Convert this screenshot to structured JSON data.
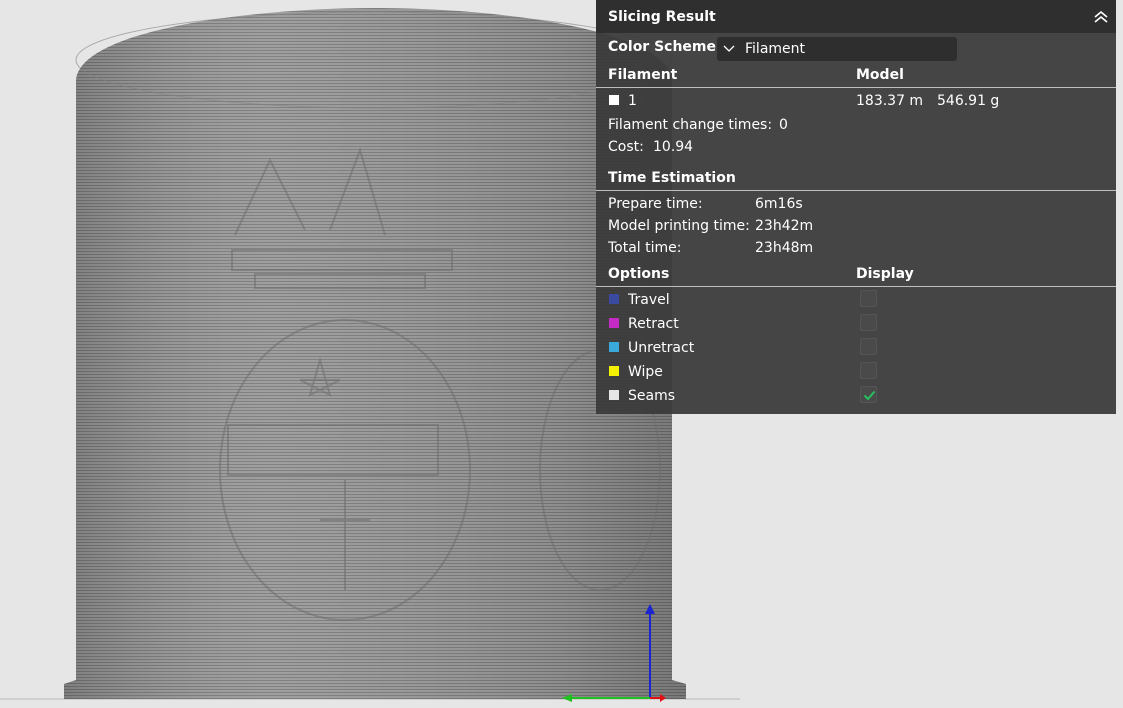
{
  "panel": {
    "title": "Slicing Result",
    "collapse_icon": "double-chevron-up-icon",
    "color_scheme": {
      "label": "Color Scheme",
      "selected": "Filament",
      "icon": "chevron-down-icon"
    },
    "filament_header": "Filament",
    "model_header": "Model",
    "filament_rows": [
      {
        "id": "1",
        "color": "#ffffff",
        "length": "183.37 m",
        "weight": "546.91 g"
      }
    ],
    "filament_change": {
      "label": "Filament change times:",
      "value": "0"
    },
    "cost": {
      "label": "Cost:",
      "value": "10.94"
    },
    "time_estimation": {
      "header": "Time Estimation",
      "rows": [
        {
          "label": "Prepare time:",
          "value": "6m16s"
        },
        {
          "label": "Model printing time:",
          "value": "23h42m"
        },
        {
          "label": "Total time:",
          "value": "23h48m"
        }
      ]
    },
    "options_header": "Options",
    "display_header": "Display",
    "options": [
      {
        "label": "Travel",
        "color": "#3a4aa0",
        "checked": false
      },
      {
        "label": "Retract",
        "color": "#c42ac4",
        "checked": false
      },
      {
        "label": "Unretract",
        "color": "#3aa8d8",
        "checked": false
      },
      {
        "label": "Wipe",
        "color": "#f5f000",
        "checked": false
      },
      {
        "label": "Seams",
        "color": "#e6e6e6",
        "checked": true
      }
    ],
    "check_color": "#27c060"
  },
  "viewport": {
    "background": "#e6e6e6",
    "model_color": "#8f8f8f",
    "axes": {
      "z_color": "#1a24d0",
      "x_color": "#e01010",
      "y_color": "#20c020"
    }
  }
}
